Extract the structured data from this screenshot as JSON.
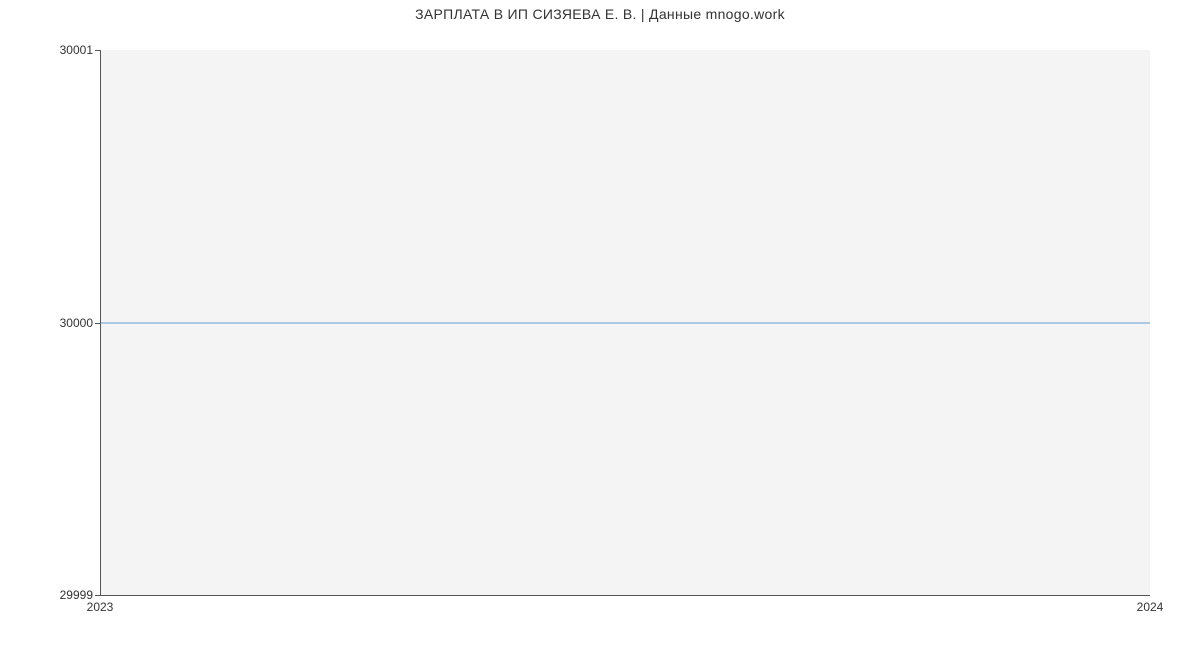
{
  "chart_data": {
    "type": "line",
    "title": "ЗАРПЛАТА В ИП СИЗЯЕВА Е. В. | Данные mnogo.work",
    "x": [
      2023,
      2024
    ],
    "values": [
      30000,
      30000
    ],
    "x_tick_labels": [
      "2023",
      "2024"
    ],
    "y_tick_labels": [
      "29999",
      "30000",
      "30001"
    ],
    "ylim": [
      29999,
      30001
    ],
    "xlim": [
      2023,
      2024
    ],
    "xlabel": "",
    "ylabel": "",
    "line_color": "#5b9bd5",
    "plot_bg": "#f4f4f4"
  }
}
